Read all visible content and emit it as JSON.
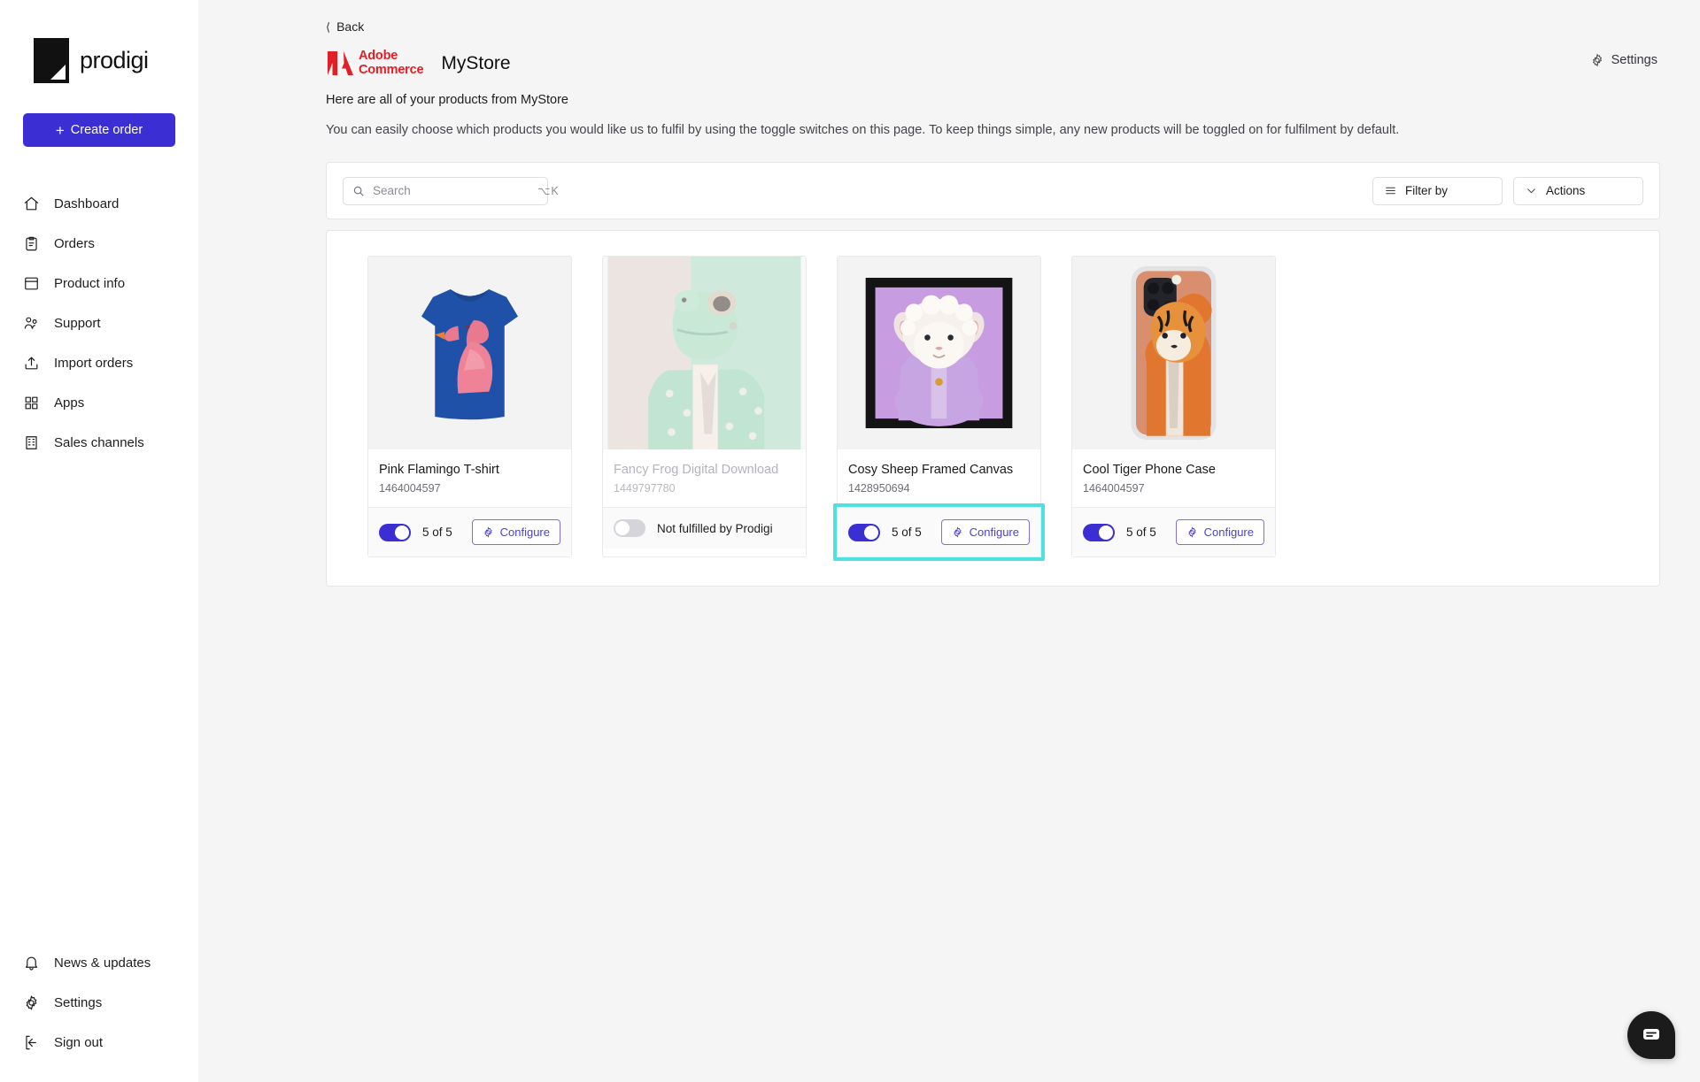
{
  "brand": {
    "name": "prodigi",
    "logo_icon": "prodigi-logo"
  },
  "sidebar": {
    "create_order_label": "Create order",
    "items": [
      {
        "label": "Dashboard",
        "icon": "home-icon"
      },
      {
        "label": "Orders",
        "icon": "clipboard-icon"
      },
      {
        "label": "Product info",
        "icon": "archive-icon"
      },
      {
        "label": "Support",
        "icon": "users-icon"
      },
      {
        "label": "Import orders",
        "icon": "upload-icon"
      },
      {
        "label": "Apps",
        "icon": "grid-icon"
      },
      {
        "label": "Sales channels",
        "icon": "building-icon"
      }
    ],
    "bottom_items": [
      {
        "label": "News & updates",
        "icon": "bell-icon"
      },
      {
        "label": "Settings",
        "icon": "gear-icon"
      },
      {
        "label": "Sign out",
        "icon": "sign-out-icon"
      }
    ]
  },
  "header": {
    "back_label": "Back",
    "channel_logo": "adobe-commerce-logo",
    "channel_line1": "Adobe",
    "channel_line2": "Commerce",
    "store_title": "MyStore",
    "settings_label": "Settings",
    "subtitle": "Here are all of your products from MyStore",
    "description": "You can easily choose which products you would like us to fulfil by using the toggle switches on this page. To keep things simple, any new products will be toggled on for fulfilment by default."
  },
  "toolbar": {
    "search_placeholder": "Search",
    "search_value": "",
    "search_shortcut": "⌥K",
    "filter_label": "Filter by",
    "actions_label": "Actions"
  },
  "products": [
    {
      "name": "Pink Flamingo T-shirt",
      "sku": "1464004597",
      "enabled": true,
      "status_label": "5 of 5",
      "configure_label": "Configure",
      "image": "pink-flamingo-tshirt",
      "highlighted": false
    },
    {
      "name": "Fancy Frog Digital Download",
      "sku": "1449797780",
      "enabled": false,
      "status_label": "Not fulfilled by Prodigi",
      "configure_label": "",
      "image": "fancy-frog-digital-download",
      "highlighted": false
    },
    {
      "name": "Cosy Sheep Framed Canvas",
      "sku": "1428950694",
      "enabled": true,
      "status_label": "5 of 5",
      "configure_label": "Configure",
      "image": "cosy-sheep-framed-canvas",
      "highlighted": true
    },
    {
      "name": "Cool Tiger Phone Case",
      "sku": "1464004597",
      "enabled": true,
      "status_label": "5 of 5",
      "configure_label": "Configure",
      "image": "cool-tiger-phone-case",
      "highlighted": false
    }
  ],
  "chat": {
    "icon": "chat-bubble-icon"
  },
  "colors": {
    "accent": "#3B2FD4",
    "configure_border": "#7C6FE8",
    "highlight": "#4FE0E0",
    "adobe_red": "#E01F26",
    "toggle_off": "#D4D4DA"
  }
}
